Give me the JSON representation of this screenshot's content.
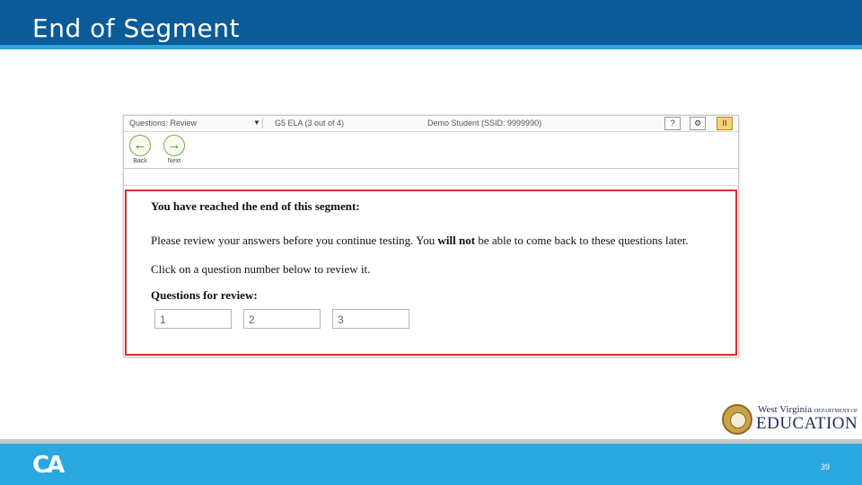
{
  "slide": {
    "title": "End of Segment",
    "page_number": "39",
    "footer_logo": "CA"
  },
  "screenshot": {
    "topbar": {
      "dropdown_label": "Questions: Review",
      "test_name": "G5 ELA (3 out of 4)",
      "student": "Demo Student (SSID: 9999990)",
      "help_label": "?",
      "settings_label": "⚙",
      "pause_label": "II"
    },
    "nav": {
      "back_label": "Back",
      "next_label": "Next"
    },
    "content": {
      "heading": "You have reached the end of this segment:",
      "line1_a": "Please review your answers before you continue testing. You ",
      "line1_bold": "will not",
      "line1_b": " be able to come back to these questions later.",
      "line2": "Click on a question number below to review it.",
      "questions_heading": "Questions for review:",
      "questions": [
        "1",
        "2",
        "3"
      ]
    }
  },
  "logo": {
    "state": "West Virginia",
    "dept": "DEPARTMENT OF",
    "word": "EDUCATION"
  },
  "colors": {
    "title_bar": "#0a5b97",
    "footer": "#2ba8e0",
    "highlight_border": "#d9302a"
  }
}
